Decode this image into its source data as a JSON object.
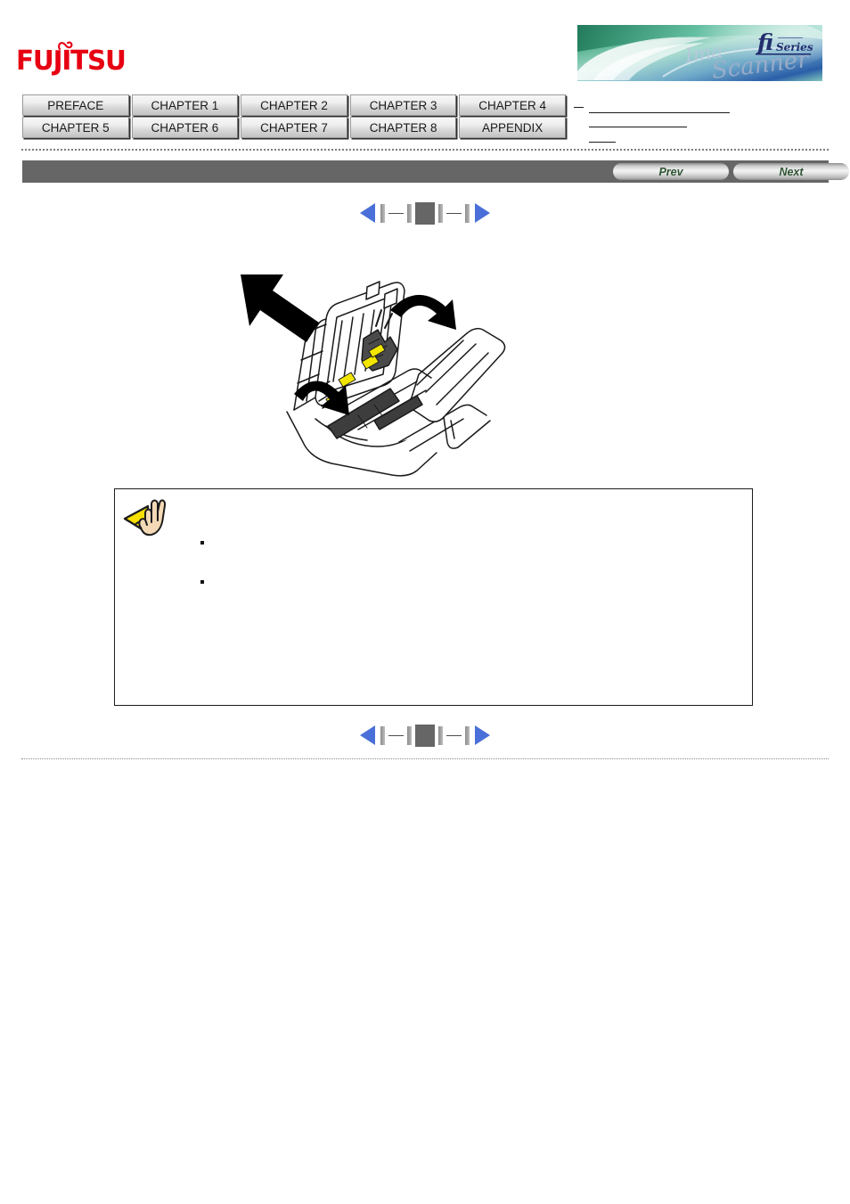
{
  "page": {
    "brand": "FUJITSU",
    "brand_color": "#e60012",
    "banner": {
      "product_line": "fi",
      "series_label": "Series",
      "subtitle": "Image Scanner",
      "alt": "fi Series Image Scanner banner"
    }
  },
  "tab_nav": {
    "rows": [
      [
        {
          "label": "PREFACE",
          "name": "tab-preface"
        },
        {
          "label": "CHAPTER 1",
          "name": "tab-chapter-1"
        },
        {
          "label": "CHAPTER 2",
          "name": "tab-chapter-2"
        },
        {
          "label": "CHAPTER 3",
          "name": "tab-chapter-3"
        },
        {
          "label": "CHAPTER 4",
          "name": "tab-chapter-4"
        }
      ],
      [
        {
          "label": "CHAPTER 5",
          "name": "tab-chapter-5"
        },
        {
          "label": "CHAPTER 6",
          "name": "tab-chapter-6"
        },
        {
          "label": "CHAPTER 7",
          "name": "tab-chapter-7"
        },
        {
          "label": "CHAPTER 8",
          "name": "tab-chapter-8"
        },
        {
          "label": "APPENDIX",
          "name": "tab-appendix"
        }
      ]
    ]
  },
  "toolbar": {
    "background": "#666666",
    "prev_label": "Prev",
    "next_label": "Next",
    "button_text_color": "#2f5434"
  },
  "page_nav": {
    "prev_icon": "triangle-left-icon",
    "next_icon": "triangle-right-icon",
    "marker_color": "#4a6fd8",
    "step_color": "#666666"
  },
  "illustration": {
    "name": "scanner-adf-open-diagram",
    "description": "Line drawing of an fi series scanner with the ADF cover opened, black arrows indicating push direction and rotation, yellow highlighted pad areas",
    "arrow_color": "#000000",
    "highlight_color": "#f2e500",
    "outline_color": "#1a1a1a"
  },
  "note_box": {
    "icon": "caution-hand-icon",
    "icon_triangle_color": "#f8e100",
    "icon_hand_color": "#f3d9b5",
    "bullets": [
      "",
      ""
    ],
    "body_text": ""
  }
}
